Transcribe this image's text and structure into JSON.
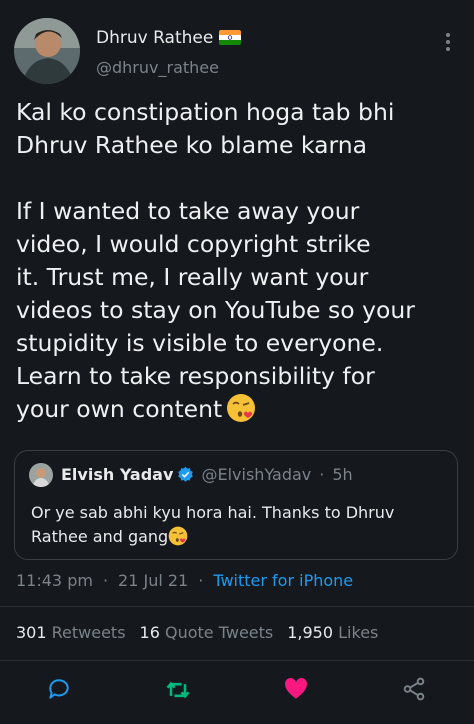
{
  "author": {
    "name": "Dhruv Rathee",
    "handle": "@dhruv_rathee",
    "flag_icon": "india-flag-icon"
  },
  "tweet": {
    "text": "Kal ko constipation hoga tab bhi\nDhruv Rathee ko blame karna\n\nIf I wanted to take away your\nvideo, I would copyright strike\nit. Trust me, I really want your\nvideos to stay on YouTube so your\nstupidity is visible to everyone.\nLearn to take responsibility for\nyour own content",
    "emoji": "face-blowing-kiss-emoji"
  },
  "quote": {
    "name": "Elvish Yadav",
    "handle": "@ElvishYadav",
    "dot": "·",
    "time": "5h",
    "text": "Or ye sab abhi kyu hora hai. Thanks to Dhruv Rathee and gang",
    "emoji": "face-blowing-kiss-emoji"
  },
  "meta": {
    "time": "11:43 pm",
    "sep1": "·",
    "date": "21 Jul 21",
    "sep2": "·",
    "source": "Twitter for iPhone"
  },
  "stats": {
    "retweets_count": "301",
    "retweets_label": "Retweets",
    "quotes_count": "16",
    "quotes_label": "Quote Tweets",
    "likes_count": "1,950",
    "likes_label": "Likes"
  },
  "colors": {
    "background": "#15181c",
    "link": "#1d9bf0",
    "retweet_green": "#00ba7c",
    "like_pink": "#f91880",
    "muted": "#7a828a"
  },
  "actions": [
    "reply-icon",
    "retweet-icon",
    "like-icon",
    "share-icon"
  ]
}
